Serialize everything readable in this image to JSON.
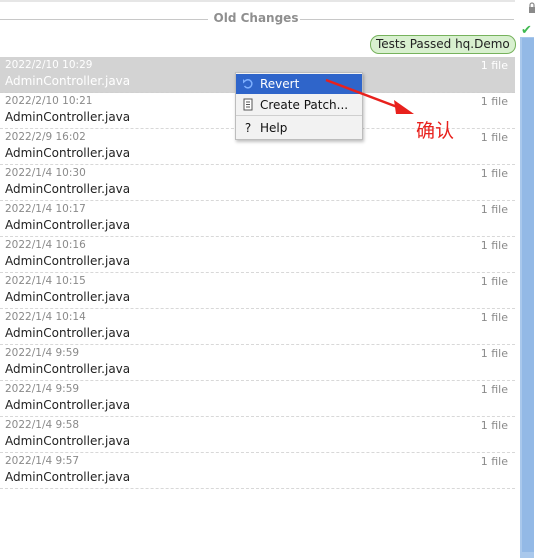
{
  "section": {
    "title": "Old Changes"
  },
  "badge": {
    "label": "Tests Passed hq.Demo",
    "color": "#d8f0cf"
  },
  "changes": [
    {
      "date": "2022/2/10 10:29",
      "file": "AdminController.java",
      "count": "1 file"
    },
    {
      "date": "2022/2/10 10:21",
      "file": "AdminController.java",
      "count": "1 file"
    },
    {
      "date": "2022/2/9 16:02",
      "file": "AdminController.java",
      "count": "1 file"
    },
    {
      "date": "2022/1/4 10:30",
      "file": "AdminController.java",
      "count": "1 file"
    },
    {
      "date": "2022/1/4 10:17",
      "file": "AdminController.java",
      "count": "1 file"
    },
    {
      "date": "2022/1/4 10:16",
      "file": "AdminController.java",
      "count": "1 file"
    },
    {
      "date": "2022/1/4 10:15",
      "file": "AdminController.java",
      "count": "1 file"
    },
    {
      "date": "2022/1/4 10:14",
      "file": "AdminController.java",
      "count": "1 file"
    },
    {
      "date": "2022/1/4 9:59",
      "file": "AdminController.java",
      "count": "1 file"
    },
    {
      "date": "2022/1/4 9:59",
      "file": "AdminController.java",
      "count": "1 file"
    },
    {
      "date": "2022/1/4 9:58",
      "file": "AdminController.java",
      "count": "1 file"
    },
    {
      "date": "2022/1/4 9:57",
      "file": "AdminController.java",
      "count": "1 file"
    }
  ],
  "context_menu": {
    "items": [
      {
        "label": "Revert",
        "icon": "revert-icon"
      },
      {
        "label": "Create Patch...",
        "icon": "patch-icon"
      },
      {
        "label": "Help",
        "icon": "help-icon"
      }
    ],
    "highlight_color": "#2f65ca"
  },
  "annotation": {
    "text": "确认",
    "color": "#e8211d"
  }
}
